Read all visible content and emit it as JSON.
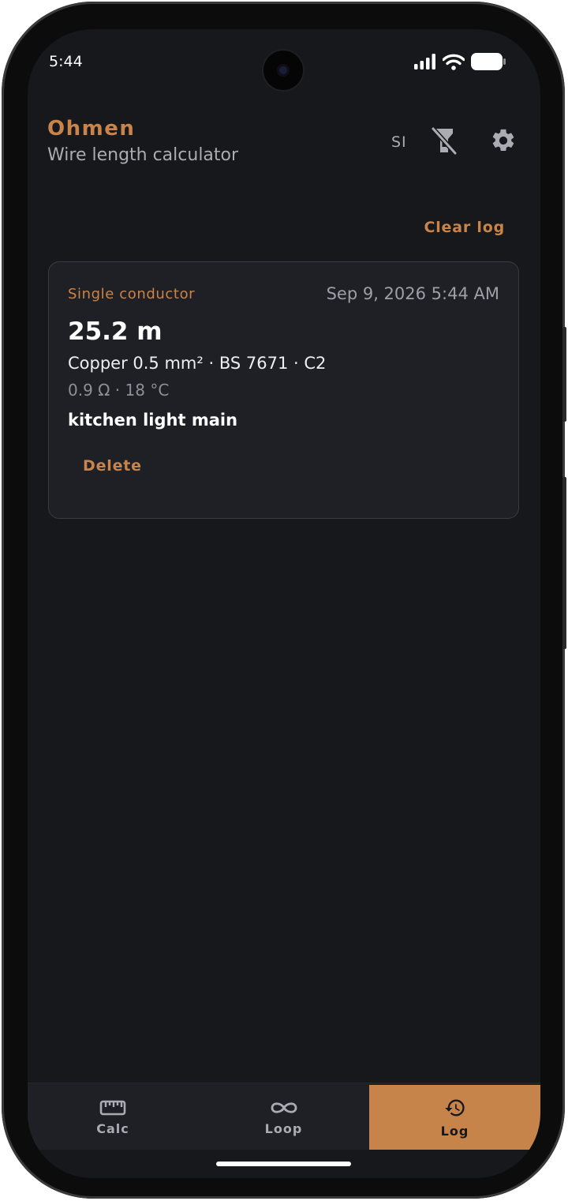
{
  "status_bar": {
    "time": "5:44"
  },
  "header": {
    "title": "Ohmen",
    "subtitle": "Wire length calculator",
    "units_label": "SI",
    "flashlight_icon": "flashlight-off-icon",
    "settings_icon": "gear-icon"
  },
  "log": {
    "clear_label": "Clear log",
    "entries": [
      {
        "type": "Single conductor",
        "datetime": "Sep 9, 2026 5:44 AM",
        "length": "25.2 m",
        "spec": "Copper 0.5 mm² · BS 7671 · C2",
        "measurement": "0.9 Ω · 18 °C",
        "note": "kitchen light main",
        "delete_label": "Delete"
      }
    ]
  },
  "tabs": [
    {
      "label": "Calc",
      "icon": "ruler-icon",
      "active": false
    },
    {
      "label": "Loop",
      "icon": "infinity-icon",
      "active": false
    },
    {
      "label": "Log",
      "icon": "history-icon",
      "active": true
    }
  ],
  "colors": {
    "accent": "#c88449",
    "background": "#17181b",
    "card": "#1f2026"
  }
}
